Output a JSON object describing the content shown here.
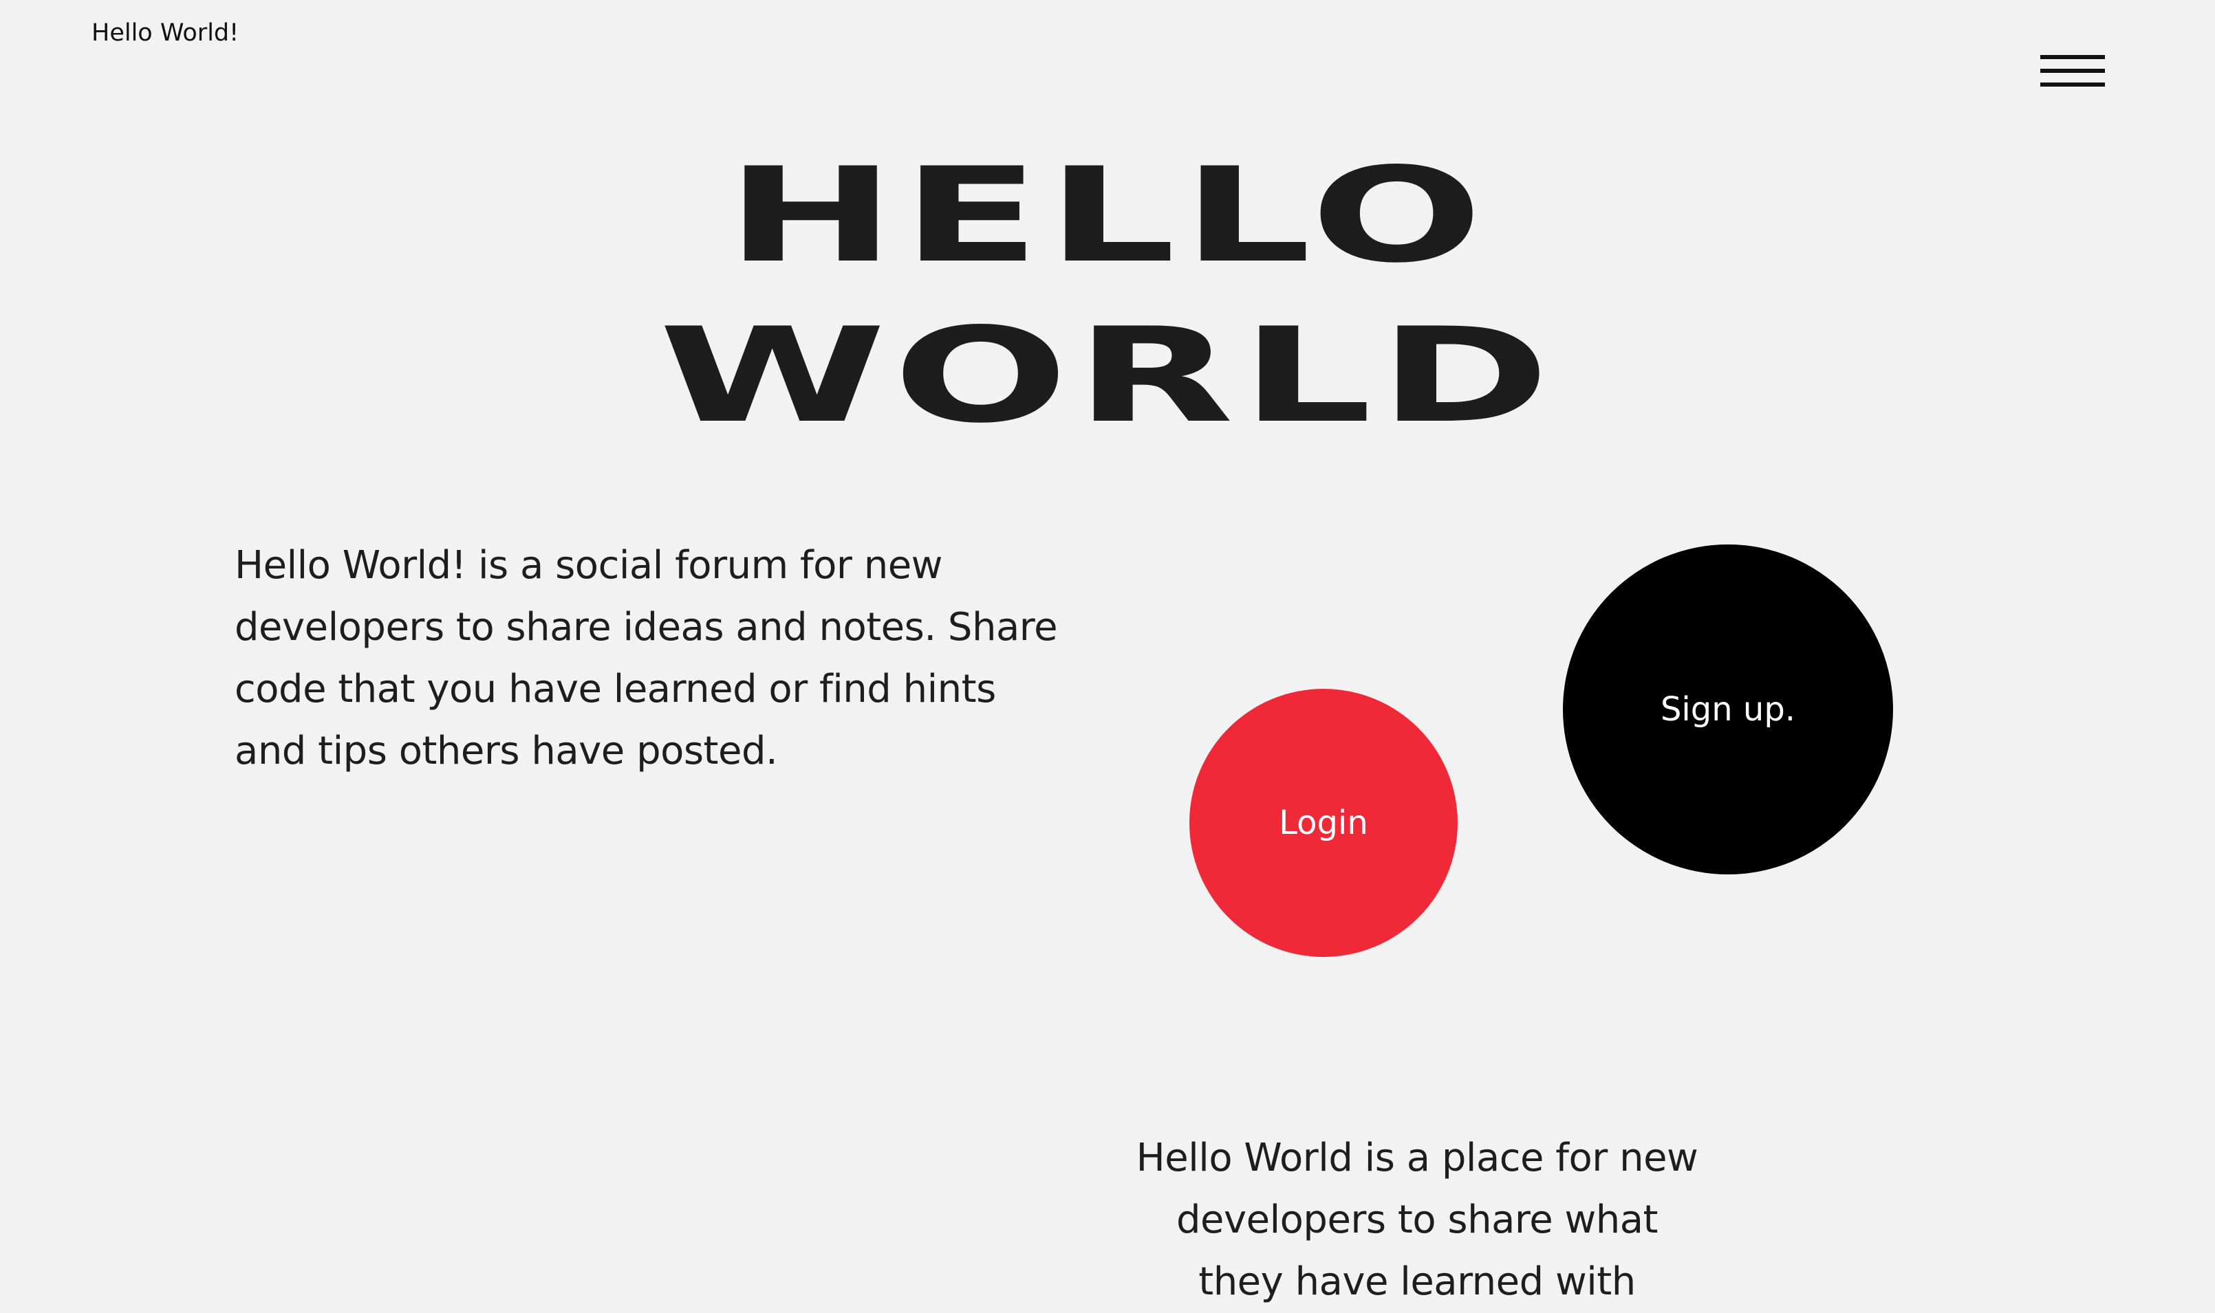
{
  "header": {
    "site_title": "Hello World!",
    "menu_icon": "hamburger-menu-icon"
  },
  "hero": {
    "line1": "HELLO",
    "line2": "WORLD"
  },
  "intro": {
    "text": "Hello World! is a social forum for new developers to share ideas and notes. Share code that you have learned or find hints and tips others have posted."
  },
  "actions": {
    "login_label": "Login",
    "signup_label": "Sign up.",
    "login_color": "#ef2938",
    "signup_color": "#000000"
  },
  "about": {
    "text": "Hello World is a place for new developers to share what they have learned with"
  }
}
